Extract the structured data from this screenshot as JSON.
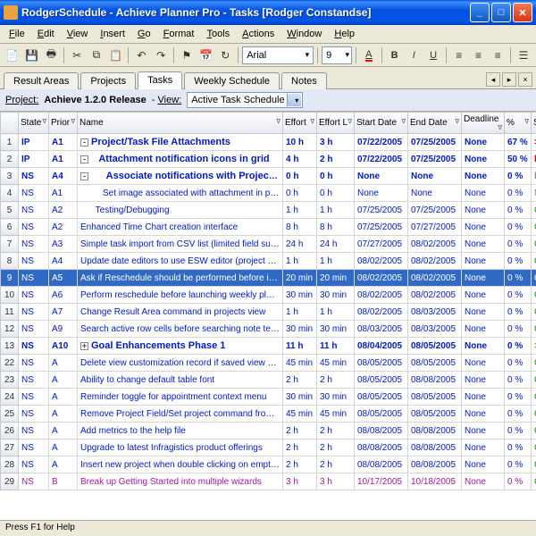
{
  "window": {
    "title": "RodgerSchedule - Achieve Planner Pro - Tasks [Rodger Constandse]"
  },
  "menu": [
    "File",
    "Edit",
    "View",
    "Insert",
    "Go",
    "Format",
    "Tools",
    "Actions",
    "Window",
    "Help"
  ],
  "font": {
    "name": "Arial",
    "size": "9"
  },
  "tabs": [
    "Result Areas",
    "Projects",
    "Tasks",
    "Weekly Schedule",
    "Notes"
  ],
  "activeTab": "Tasks",
  "info": {
    "projectLabel": "Project:",
    "project": "Achieve 1.2.0 Release",
    "viewLabel": "View:",
    "view": "Active Task Schedule"
  },
  "cols": [
    "",
    "State",
    "Prior",
    "Name",
    "Effort",
    "Effort L",
    "Start Date",
    "End Date",
    "Deadline",
    "%",
    "Status"
  ],
  "rows": [
    {
      "n": "1",
      "state": "IP",
      "pr": "A1",
      "name": "Project/Task File Attachments",
      "ind": 0,
      "bold": true,
      "tog": "-",
      "eff": "10 h",
      "effL": "3 h",
      "sd": "07/22/2005",
      "ed": "07/25/2005",
      "dl": "None",
      "pc": "67 %",
      "st": "Due Soon",
      "boldRow": true,
      "stCls": "red-b",
      "stPre": ">"
    },
    {
      "n": "2",
      "state": "IP",
      "pr": "A1",
      "name": "Attachment notification icons in grid",
      "ind": 1,
      "bold": true,
      "tog": "-",
      "eff": "4 h",
      "effL": "2 h",
      "sd": "07/22/2005",
      "ed": "07/25/2005",
      "dl": "None",
      "pc": "50 %",
      "st": "Due Soon",
      "boldRow": true,
      "stCls": "red-b"
    },
    {
      "n": "3",
      "state": "NS",
      "pr": "A4",
      "name": "Associate notifications with Project/Task",
      "ind": 2,
      "bold": true,
      "tog": "-",
      "eff": "0 h",
      "effL": "0 h",
      "sd": "None",
      "ed": "None",
      "dl": "None",
      "pc": "0 %",
      "st": "Not Scheduled",
      "boldRow": true,
      "stCls": "gray"
    },
    {
      "n": "4",
      "state": "NS",
      "pr": "A1",
      "name": "Set image associated with attachment in project grid view",
      "ind": 3,
      "eff": "0 h",
      "effL": "0 h",
      "sd": "None",
      "ed": "None",
      "dl": "None",
      "pc": "0 %",
      "st": "Not Scheduled",
      "stCls": "gray"
    },
    {
      "n": "5",
      "state": "NS",
      "pr": "A2",
      "name": "Testing/Debugging",
      "ind": 2,
      "eff": "1 h",
      "effL": "1 h",
      "sd": "07/25/2005",
      "ed": "07/25/2005",
      "dl": "None",
      "pc": "0 %",
      "st": "On Schedule",
      "stCls": "green"
    },
    {
      "n": "6",
      "state": "NS",
      "pr": "A2",
      "name": "Enhanced Time Chart creation interface",
      "ind": 0,
      "eff": "8 h",
      "effL": "8 h",
      "sd": "07/25/2005",
      "ed": "07/27/2005",
      "dl": "None",
      "pc": "0 %",
      "st": "On Schedule",
      "stCls": "green"
    },
    {
      "n": "7",
      "state": "NS",
      "pr": "A3",
      "name": "Simple task import from CSV list (limited field support)",
      "ind": 0,
      "eff": "24 h",
      "effL": "24 h",
      "sd": "07/27/2005",
      "ed": "08/02/2005",
      "dl": "None",
      "pc": "0 %",
      "st": "On Schedule",
      "stCls": "green"
    },
    {
      "n": "8",
      "state": "NS",
      "pr": "A4",
      "name": "Update date editors to use ESW editor (project general page for example",
      "ind": 0,
      "eff": "1 h",
      "effL": "1 h",
      "sd": "08/02/2005",
      "ed": "08/02/2005",
      "dl": "None",
      "pc": "0 %",
      "st": "On Schedule",
      "stCls": "green"
    },
    {
      "n": "9",
      "state": "NS",
      "pr": "A5",
      "name": "Ask if Reschedule should be performed before invoking DPZ",
      "ind": 0,
      "eff": "20 min",
      "effL": "20 min",
      "sd": "08/02/2005",
      "ed": "08/02/2005",
      "dl": "None",
      "pc": "0 %",
      "st": "On Schedule",
      "stCls": "green",
      "sel": true
    },
    {
      "n": "10",
      "state": "NS",
      "pr": "A6",
      "name": "Perform reschedule before launching weekly planning wizard",
      "ind": 0,
      "eff": "30 min",
      "effL": "30 min",
      "sd": "08/02/2005",
      "ed": "08/02/2005",
      "dl": "None",
      "pc": "0 %",
      "st": "On Schedule",
      "stCls": "green"
    },
    {
      "n": "11",
      "state": "NS",
      "pr": "A7",
      "name": "Change Result Area command in projects view",
      "ind": 0,
      "eff": "1 h",
      "effL": "1 h",
      "sd": "08/02/2005",
      "ed": "08/03/2005",
      "dl": "None",
      "pc": "0 %",
      "st": "On Schedule",
      "stCls": "green"
    },
    {
      "n": "12",
      "state": "NS",
      "pr": "A9",
      "name": "Search active row cells before searching note text in Notes view",
      "ind": 0,
      "eff": "30 min",
      "effL": "30 min",
      "sd": "08/03/2005",
      "ed": "08/03/2005",
      "dl": "None",
      "pc": "0 %",
      "st": "On Schedule",
      "stCls": "green"
    },
    {
      "n": "13",
      "state": "NS",
      "pr": "A10",
      "name": "Goal Enhancements Phase 1",
      "ind": 0,
      "bold": true,
      "tog": "+",
      "eff": "11 h",
      "effL": "11 h",
      "sd": "08/04/2005",
      "ed": "08/05/2005",
      "dl": "None",
      "pc": "0 %",
      "st": "On Schedule",
      "boldRow": true,
      "stCls": "green",
      "stPre": ">"
    },
    {
      "n": "22",
      "state": "NS",
      "pr": "A",
      "name": "Delete view customization record if saved view matches the standard vie",
      "ind": 0,
      "eff": "45 min",
      "effL": "45 min",
      "sd": "08/05/2005",
      "ed": "08/05/2005",
      "dl": "None",
      "pc": "0 %",
      "st": "On Schedule",
      "stCls": "green"
    },
    {
      "n": "23",
      "state": "NS",
      "pr": "A",
      "name": "Ability to change default table font",
      "ind": 0,
      "eff": "2 h",
      "effL": "2 h",
      "sd": "08/05/2005",
      "ed": "08/08/2005",
      "dl": "None",
      "pc": "0 %",
      "st": "On Schedule",
      "stCls": "green"
    },
    {
      "n": "24",
      "state": "NS",
      "pr": "A",
      "name": "Reminder toggle for appointment context menu",
      "ind": 0,
      "eff": "30 min",
      "effL": "30 min",
      "sd": "08/05/2005",
      "ed": "08/05/2005",
      "dl": "None",
      "pc": "0 %",
      "st": "On Schedule",
      "stCls": "green"
    },
    {
      "n": "25",
      "state": "NS",
      "pr": "A",
      "name": "Remove Project Field/Set project command from Goal Step in GO produ",
      "ind": 0,
      "eff": "45 min",
      "effL": "45 min",
      "sd": "08/05/2005",
      "ed": "08/05/2005",
      "dl": "None",
      "pc": "0 %",
      "st": "On Schedule",
      "stCls": "green"
    },
    {
      "n": "26",
      "state": "NS",
      "pr": "A",
      "name": "Add metrics to the help file",
      "ind": 0,
      "eff": "2 h",
      "effL": "2 h",
      "sd": "08/08/2005",
      "ed": "08/08/2005",
      "dl": "None",
      "pc": "0 %",
      "st": "On Schedule",
      "stCls": "green"
    },
    {
      "n": "27",
      "state": "NS",
      "pr": "A",
      "name": "Upgrade to latest Infragistics product offerings",
      "ind": 0,
      "eff": "2 h",
      "effL": "2 h",
      "sd": "08/08/2005",
      "ed": "08/08/2005",
      "dl": "None",
      "pc": "0 %",
      "st": "On Schedule",
      "stCls": "green"
    },
    {
      "n": "28",
      "state": "NS",
      "pr": "A",
      "name": "Insert new project when double clicking on empty area below projects",
      "ind": 0,
      "eff": "2 h",
      "effL": "2 h",
      "sd": "08/08/2005",
      "ed": "08/08/2005",
      "dl": "None",
      "pc": "0 %",
      "st": "On Schedule",
      "stCls": "green"
    },
    {
      "n": "29",
      "state": "NS",
      "pr": "B",
      "name": "Break up Getting Started into multiple wizards",
      "ind": 0,
      "eff": "3 h",
      "effL": "3 h",
      "sd": "10/17/2005",
      "ed": "10/18/2005",
      "dl": "None",
      "pc": "0 %",
      "st": "On Schedule",
      "stCls": "green",
      "purple": true
    }
  ],
  "status": "Press F1 for Help"
}
